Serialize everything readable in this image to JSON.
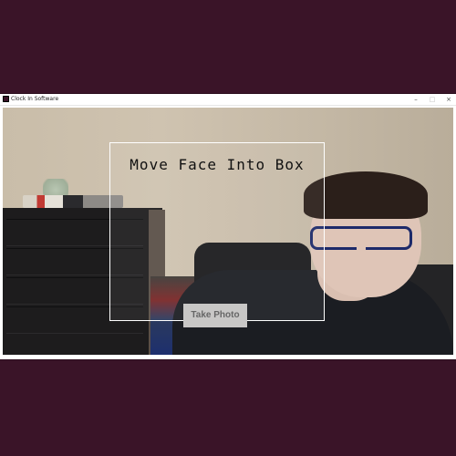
{
  "window": {
    "title": "Clock In Software",
    "controls": {
      "minimize": "–",
      "maximize": "□",
      "close": "×"
    }
  },
  "camera": {
    "prompt": "Move Face Into Box",
    "button_label": "Take Photo"
  },
  "colors": {
    "desktop_background": "#3a1428",
    "window_background": "#ffffff",
    "face_box_border": "#ffffff",
    "button_background": "#c8c7c6"
  }
}
